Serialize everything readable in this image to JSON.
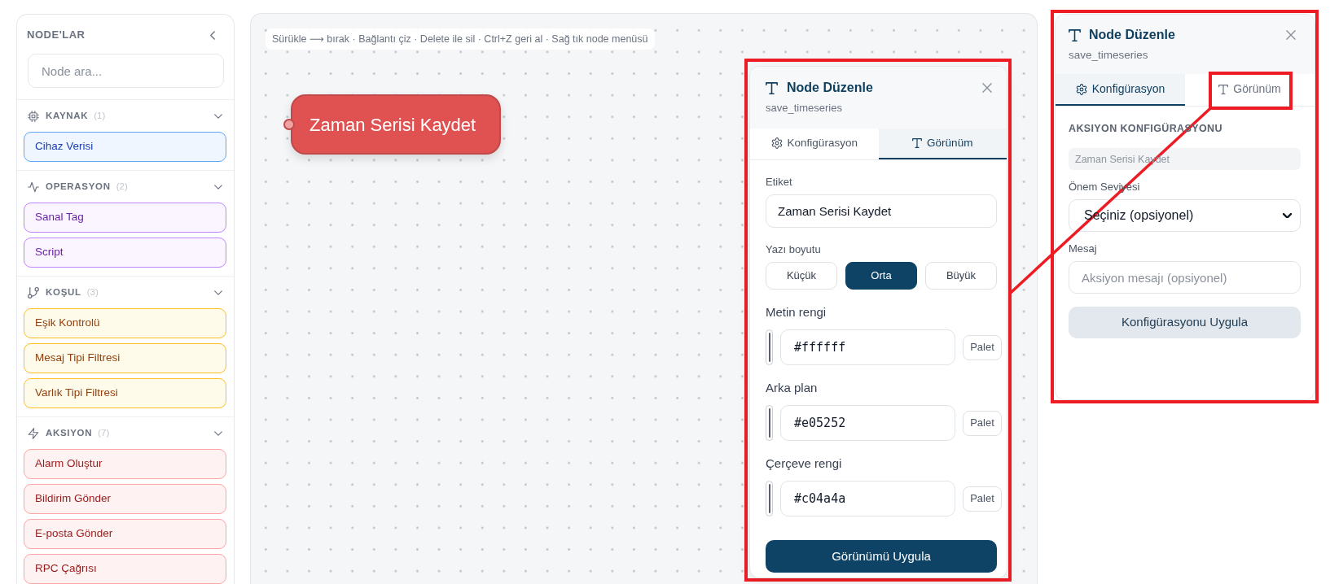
{
  "sidebar": {
    "title": "NODE'LAR",
    "search": {
      "placeholder": "Node ara..."
    },
    "groups": [
      {
        "kind": "source",
        "title": "KAYNAK",
        "count": "(1)",
        "expanded": true,
        "items": [
          {
            "label": "Cihaz Verisi"
          }
        ]
      },
      {
        "kind": "operation",
        "title": "OPERASYON",
        "count": "(2)",
        "expanded": true,
        "items": [
          {
            "label": "Sanal Tag"
          },
          {
            "label": "Script"
          }
        ]
      },
      {
        "kind": "condition",
        "title": "KOŞUL",
        "count": "(3)",
        "expanded": true,
        "items": [
          {
            "label": "Eşik Kontrolü"
          },
          {
            "label": "Mesaj Tipi Filtresi"
          },
          {
            "label": "Varlık Tipi Filtresi"
          }
        ]
      },
      {
        "kind": "action",
        "title": "AKSIYON",
        "count": "(7)",
        "expanded": true,
        "items": [
          {
            "label": "Alarm Oluştur"
          },
          {
            "label": "Bildirim Gönder"
          },
          {
            "label": "E-posta Gönder"
          },
          {
            "label": "RPC Çağrısı"
          }
        ]
      }
    ]
  },
  "canvas": {
    "hint": "Sürükle ⟶ bırak · Bağlantı çiz · Delete ile sil · Ctrl+Z geri al · Sağ tık node menüsü",
    "nodes": [
      {
        "label": "Zaman Serisi Kaydet"
      }
    ]
  },
  "edit_panel": {
    "highlighted": true,
    "title": "Node Düzenle",
    "subtitle": "save_timeseries",
    "tabs": [
      {
        "kind": "config",
        "label": "Konfigürasyon",
        "selected": false
      },
      {
        "kind": "appearance",
        "label": "Görünüm",
        "selected": true
      }
    ],
    "label_field": {
      "label": "Etiket",
      "value": "Zaman Serisi Kaydet"
    },
    "font_size": {
      "label": "Yazı boyutu",
      "options": [
        {
          "label": "Küçük",
          "selected": false
        },
        {
          "label": "Orta",
          "selected": true
        },
        {
          "label": "Büyük",
          "selected": false
        }
      ]
    },
    "colors": [
      {
        "label": "Metin rengi",
        "value": "#ffffff",
        "button": "Palet"
      },
      {
        "label": "Arka plan",
        "value": "#e05252",
        "button": "Palet"
      },
      {
        "label": "Çerçeve rengi",
        "value": "#c04a4a",
        "button": "Palet"
      }
    ],
    "apply_button": "Görünümü Uygula"
  },
  "side_panel": {
    "highlighted": true,
    "title": "Node Düzenle",
    "subtitle": "save_timeseries",
    "tabs": [
      {
        "kind": "config",
        "label": "Konfigürasyon",
        "selected": true,
        "highlighted": false
      },
      {
        "kind": "appearance",
        "label": "Görünüm",
        "selected": false,
        "highlighted": true
      }
    ],
    "section_title": "AKSIYON KONFIGÜRASYONU",
    "name_field": {
      "value": "Zaman Serisi Kaydet",
      "disabled": true
    },
    "severity": {
      "label": "Önem Seviyesi",
      "value": "Seçiniz (opsiyonel)"
    },
    "message": {
      "label": "Mesaj",
      "placeholder": "Aksiyon mesajı (opsiyonel)"
    },
    "apply_button": "Konfigürasyonu Uygula"
  },
  "connector_line": true
}
